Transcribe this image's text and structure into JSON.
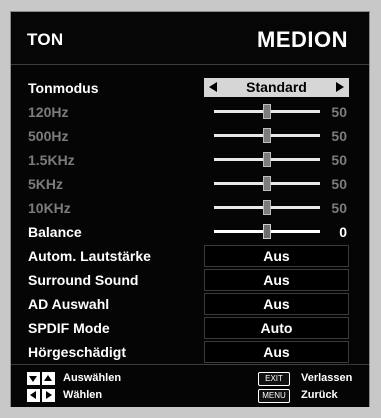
{
  "menu": {
    "title": "TON",
    "brand": "MEDION"
  },
  "rows": [
    {
      "label": "Tonmodus",
      "type": "selector",
      "value": "Standard",
      "enabled": true
    },
    {
      "label": "120Hz",
      "type": "slider",
      "value": "50",
      "level": 50,
      "enabled": false
    },
    {
      "label": "500Hz",
      "type": "slider",
      "value": "50",
      "level": 50,
      "enabled": false
    },
    {
      "label": "1.5KHz",
      "type": "slider",
      "value": "50",
      "level": 50,
      "enabled": false
    },
    {
      "label": "5KHz",
      "type": "slider",
      "value": "50",
      "level": 50,
      "enabled": false
    },
    {
      "label": "10KHz",
      "type": "slider",
      "value": "50",
      "level": 50,
      "enabled": false
    },
    {
      "label": "Balance",
      "type": "slider",
      "value": "0",
      "level": 50,
      "enabled": true
    },
    {
      "label": "Autom. Lautstärke",
      "type": "box",
      "value": "Aus",
      "enabled": true
    },
    {
      "label": "Surround Sound",
      "type": "box",
      "value": "Aus",
      "enabled": true
    },
    {
      "label": "AD Auswahl",
      "type": "box",
      "value": "Aus",
      "enabled": true
    },
    {
      "label": "SPDIF Mode",
      "type": "box",
      "value": "Auto",
      "enabled": true
    },
    {
      "label": "Hörgeschädigt",
      "type": "box",
      "value": "Aus",
      "enabled": true
    }
  ],
  "footer": {
    "select_label": "Auswählen",
    "choose_label": "Wählen",
    "exit_key": "EXIT",
    "exit_label": "Verlassen",
    "menu_key": "MENU",
    "back_label": "Zurück"
  },
  "colors": {
    "background": "#050505",
    "selector_highlight": "#d6d6d6",
    "disabled_text": "#7c7c7c"
  },
  "icons": [
    "up-down-arrow-keys-icon",
    "left-right-arrow-keys-icon"
  ]
}
